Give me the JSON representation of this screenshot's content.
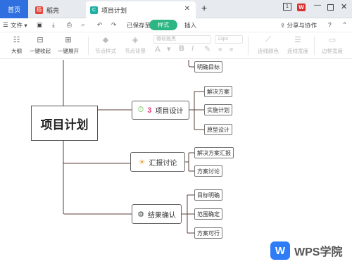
{
  "tabs": {
    "home": "首页",
    "daoke": "稻壳",
    "active": "项目计划",
    "new": "+"
  },
  "window": {
    "counter": "1",
    "minimize": "—"
  },
  "toolbar": {
    "menu_label": "文件",
    "saved_status": "已保存至",
    "active_pill": "样式",
    "insert": "插入",
    "share": "分享与协作",
    "help": "?"
  },
  "tools": {
    "outline": "大纲",
    "collapse_all": "一键收起",
    "expand_all": "一键展开",
    "node_style": "节点样式",
    "node_bg": "节点背景",
    "font_family": "微软雅黑",
    "font_size": "13px",
    "line_color": "连线颜色",
    "line_width": "连线宽度",
    "border_width": "边框宽度"
  },
  "mindmap": {
    "root": "项目计划",
    "top_leaf": "明确目标",
    "branches": [
      {
        "label": "项目设计",
        "icons": [
          "stopwatch-icon",
          "badge-3-icon"
        ],
        "leaves": [
          "解决方案",
          "实施计划",
          "原型设计"
        ]
      },
      {
        "label": "汇报讨论",
        "icons": [
          "bulb-icon"
        ],
        "leaves": [
          "解决方案汇报",
          "方案讨论"
        ]
      },
      {
        "label": "结果确认",
        "icons": [
          "gear-icon"
        ],
        "leaves": [
          "目标明确",
          "范围确定",
          "方案可行"
        ]
      }
    ]
  },
  "watermark": {
    "logo": "W",
    "text": "WPS学院"
  },
  "colors": {
    "accent": "#2f6fdf",
    "pill": "#2bb683",
    "wps_red": "#d9302f",
    "line": "#5a3f3a"
  }
}
